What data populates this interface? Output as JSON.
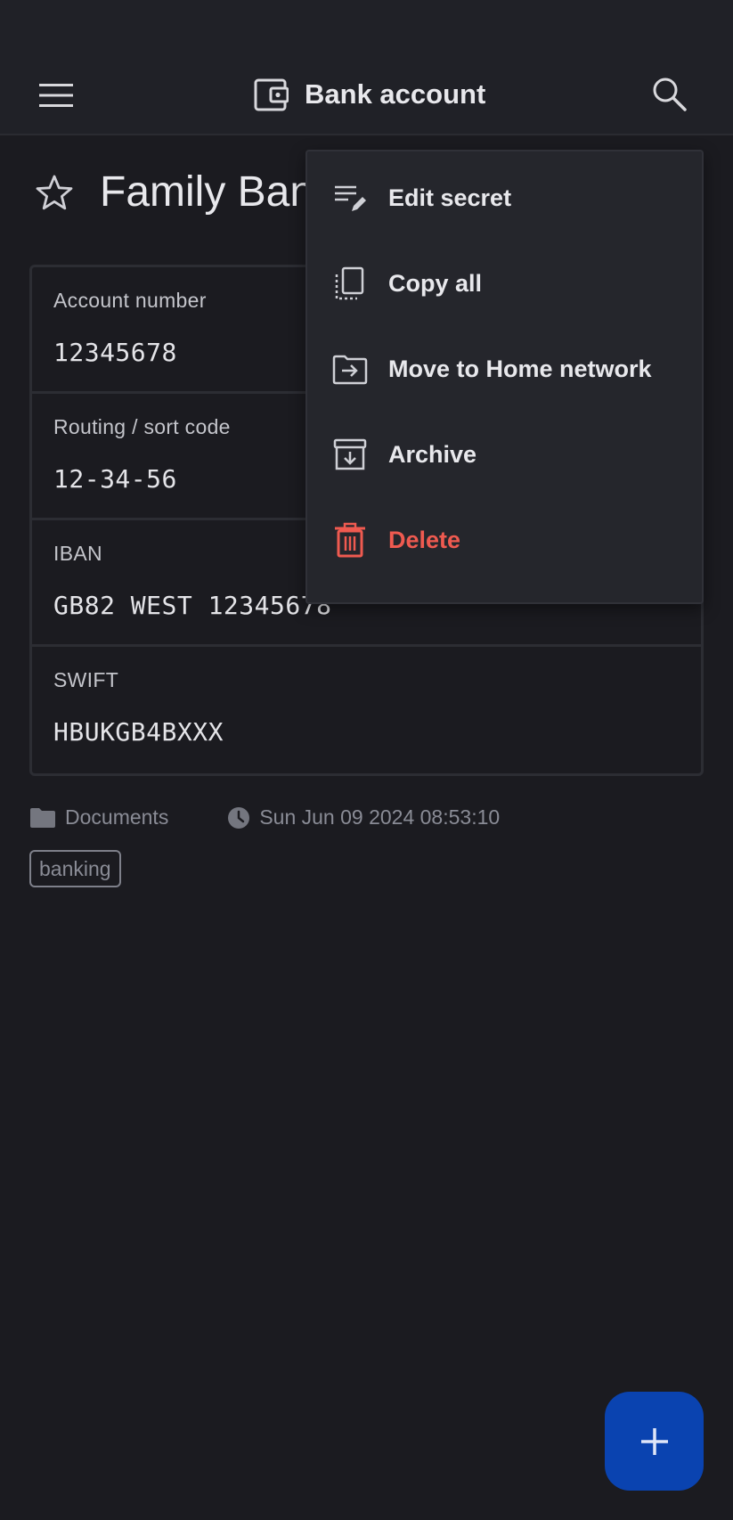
{
  "appbar": {
    "title": "Bank account",
    "icons": {
      "menu": "hamburger-menu-icon",
      "type": "wallet-icon",
      "search": "search-icon"
    }
  },
  "secret": {
    "title": "Family Ban",
    "favorite_icon": "star-outline-icon"
  },
  "fields": [
    {
      "label": "Account number",
      "value": "12345678"
    },
    {
      "label": "Routing / sort code",
      "value": "12-34-56"
    },
    {
      "label": "IBAN",
      "value": "GB82 WEST 12345678"
    },
    {
      "label": "SWIFT",
      "value": "HBUKGB4BXXX"
    }
  ],
  "meta": {
    "folder": "Documents",
    "timestamp": "Sun Jun 09 2024 08:53:10"
  },
  "tags": [
    "banking"
  ],
  "menu": [
    {
      "label": "Edit secret",
      "icon": "edit-notes-icon"
    },
    {
      "label": "Copy all",
      "icon": "copy-icon"
    },
    {
      "label": "Move to Home network",
      "icon": "move-folder-icon"
    },
    {
      "label": "Archive",
      "icon": "archive-icon"
    },
    {
      "label": "Delete",
      "icon": "trash-icon"
    }
  ],
  "fab": {
    "icon": "plus-icon"
  },
  "colors": {
    "background": "#1b1b20",
    "appbar": "#202127",
    "menu_bg": "#25262c",
    "danger": "#ef5a50",
    "fab": "#0a43b0"
  }
}
